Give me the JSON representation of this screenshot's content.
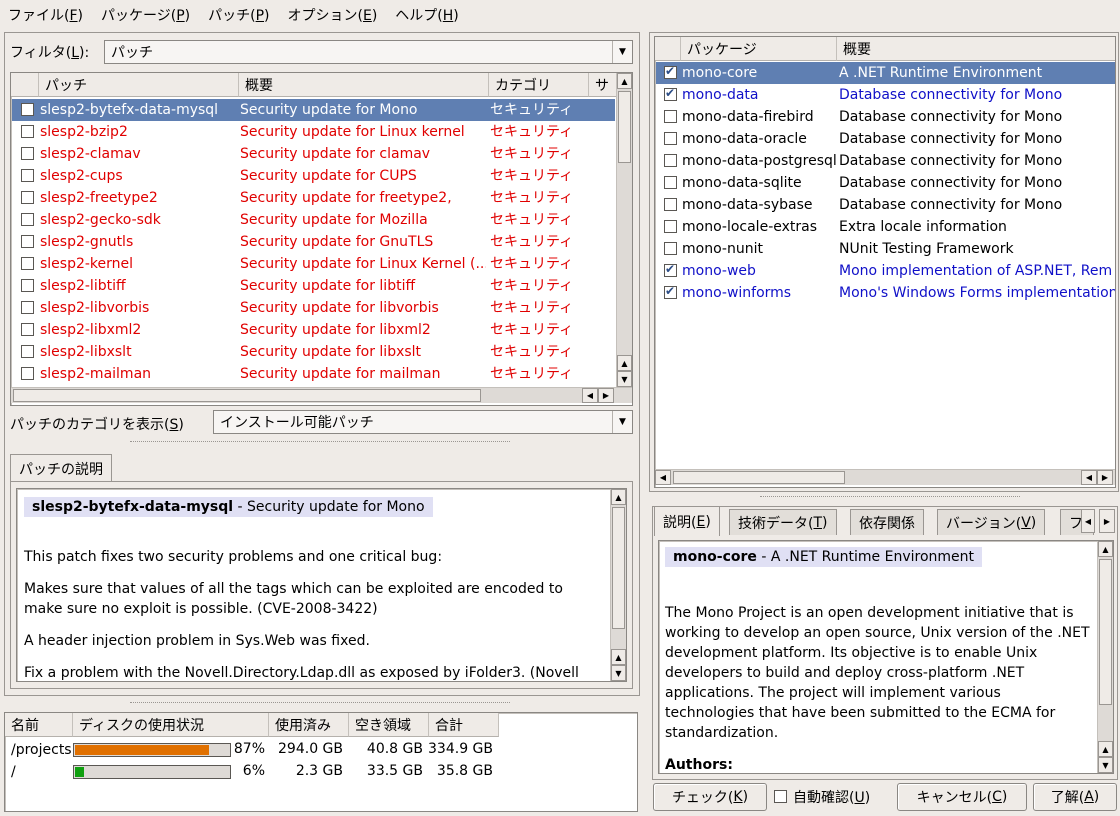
{
  "menu": [
    {
      "label": "ファイル(",
      "key": "F",
      "end": ")"
    },
    {
      "label": "パッケージ(",
      "key": "P",
      "end": ")"
    },
    {
      "label": "パッチ(",
      "key": "P",
      "end": ")"
    },
    {
      "label": "オプション(",
      "key": "E",
      "end": ")"
    },
    {
      "label": "ヘルプ(",
      "key": "H",
      "end": ")"
    }
  ],
  "filter": {
    "label_a": "フィルタ(",
    "key": "L",
    "label_b": "):",
    "value": "パッチ"
  },
  "patch_table": {
    "headers": [
      "パッチ",
      "概要",
      "カテゴリ",
      "サ"
    ],
    "rows": [
      {
        "name": "slesp2-bytefx-data-mysql",
        "summary": "Security update for Mono",
        "category": "セキュリティ",
        "selected": true
      },
      {
        "name": "slesp2-bzip2",
        "summary": "Security update for Linux kernel",
        "category": "セキュリティ"
      },
      {
        "name": "slesp2-clamav",
        "summary": "Security update for clamav",
        "category": "セキュリティ"
      },
      {
        "name": "slesp2-cups",
        "summary": "Security update for CUPS",
        "category": "セキュリティ"
      },
      {
        "name": "slesp2-freetype2",
        "summary": "Security update for freetype2,",
        "category": "セキュリティ"
      },
      {
        "name": "slesp2-gecko-sdk",
        "summary": "Security update for Mozilla",
        "category": "セキュリティ"
      },
      {
        "name": "slesp2-gnutls",
        "summary": "Security update for GnuTLS",
        "category": "セキュリティ"
      },
      {
        "name": "slesp2-kernel",
        "summary": "Security update for Linux Kernel (...",
        "category": "セキュリティ"
      },
      {
        "name": "slesp2-libtiff",
        "summary": "Security update for libtiff",
        "category": "セキュリティ"
      },
      {
        "name": "slesp2-libvorbis",
        "summary": "Security update for libvorbis",
        "category": "セキュリティ"
      },
      {
        "name": "slesp2-libxml2",
        "summary": "Security update for libxml2",
        "category": "セキュリティ"
      },
      {
        "name": "slesp2-libxslt",
        "summary": "Security update for libxslt",
        "category": "セキュリティ"
      },
      {
        "name": "slesp2-mailman",
        "summary": "Security update for mailman",
        "category": "セキュリティ"
      }
    ]
  },
  "category_filter": {
    "label_a": "パッチのカテゴリを表示(",
    "key": "S",
    "label_b": ")",
    "value": "インストール可能パッチ"
  },
  "patch_desc": {
    "tab": "パッチの説明",
    "title_bold": "slesp2-bytefx-data-mysql",
    "title_rest": " - Security update for Mono",
    "paragraphs": [
      "This patch fixes two security problems and one critical bug:",
      "Makes sure that values of all the tags which can be exploited are encoded to make sure no exploit is possible. (CVE-2008-3422)",
      "A header injection problem in Sys.Web was fixed.",
      "Fix a problem with the Novell.Directory.Ldap.dll as exposed by iFolder3. (Novell"
    ]
  },
  "disk": {
    "headers": [
      "名前",
      "ディスクの使用状況",
      "使用済み",
      "空き領域",
      "合計"
    ],
    "rows": [
      {
        "name": "/projects",
        "fraction": 0.87,
        "percent": "87%",
        "used": "294.0 GB",
        "free": "40.8 GB",
        "total": "334.9 GB",
        "color": "#e07000"
      },
      {
        "name": "/",
        "fraction": 0.06,
        "percent": "6%",
        "used": "2.3 GB",
        "free": "33.5 GB",
        "total": "35.8 GB",
        "color": "#10a010"
      }
    ]
  },
  "package_table": {
    "headers": [
      "パッケージ",
      "概要"
    ],
    "rows": [
      {
        "name": "mono-core",
        "summary": "A .NET Runtime Environment",
        "checked": true,
        "selected": true,
        "style": "normal"
      },
      {
        "name": "mono-data",
        "summary": "Database connectivity for Mono",
        "checked": true,
        "style": "blue"
      },
      {
        "name": "mono-data-firebird",
        "summary": "Database connectivity for Mono",
        "checked": false,
        "style": "normal"
      },
      {
        "name": "mono-data-oracle",
        "summary": "Database connectivity for Mono",
        "checked": false,
        "style": "normal"
      },
      {
        "name": "mono-data-postgresql",
        "summary": "Database connectivity for Mono",
        "checked": false,
        "style": "normal"
      },
      {
        "name": "mono-data-sqlite",
        "summary": "Database connectivity for Mono",
        "checked": false,
        "style": "normal"
      },
      {
        "name": "mono-data-sybase",
        "summary": "Database connectivity for Mono",
        "checked": false,
        "style": "normal"
      },
      {
        "name": "mono-locale-extras",
        "summary": "Extra locale information",
        "checked": false,
        "style": "normal"
      },
      {
        "name": "mono-nunit",
        "summary": "NUnit Testing Framework",
        "checked": false,
        "style": "normal"
      },
      {
        "name": "mono-web",
        "summary": "Mono implementation of ASP.NET, Rem",
        "checked": true,
        "style": "blue"
      },
      {
        "name": "mono-winforms",
        "summary": "Mono's Windows Forms implementation",
        "checked": true,
        "style": "blue"
      }
    ]
  },
  "info_tabs": [
    {
      "label_a": "説明(",
      "key": "E",
      "label_b": ")"
    },
    {
      "label_a": "技術データ(",
      "key": "T",
      "label_b": ")"
    },
    {
      "label_a": "依存関係",
      "key": "",
      "label_b": ""
    },
    {
      "label_a": "バージョン(",
      "key": "V",
      "label_b": ")"
    },
    {
      "label_a": "フ",
      "key": "",
      "label_b": ""
    }
  ],
  "package_desc": {
    "title_bold": "mono-core",
    "title_rest": " - A .NET Runtime Environment",
    "paragraph": "The Mono Project is an open development initiative that is working to develop an open source, Unix version of the .NET development platform. Its objective is to enable Unix developers to build and deploy cross-platform .NET applications. The project will implement various technologies that have been submitted to the ECMA for standardization.",
    "authors_label": "Authors:"
  },
  "buttons": {
    "check": {
      "label_a": "チェック(",
      "key": "K",
      "label_b": ")"
    },
    "autocheck": {
      "label_a": "自動確認(",
      "key": "U",
      "label_b": ")"
    },
    "cancel": {
      "label_a": "キャンセル(",
      "key": "C",
      "label_b": ")"
    },
    "accept": {
      "label_a": "了解(",
      "key": "A",
      "label_b": ")"
    }
  },
  "colors": {
    "selection": "#5f7fb2",
    "patch_text": "#e00000",
    "installed_text": "#1010c8"
  }
}
